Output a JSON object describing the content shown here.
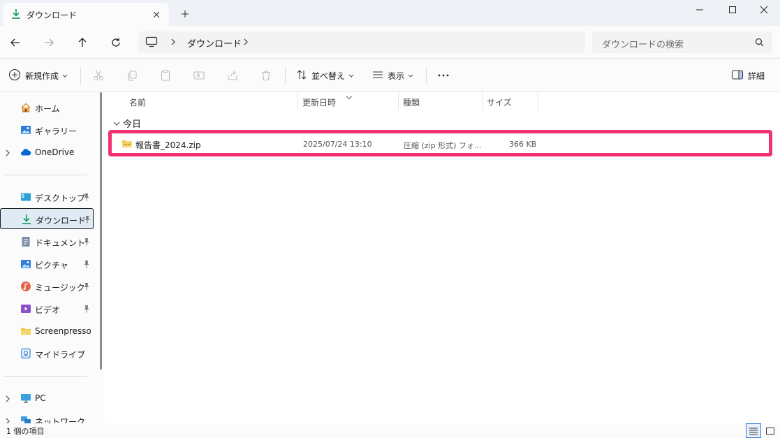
{
  "tab": {
    "title": "ダウンロード"
  },
  "address": {
    "crumb": "ダウンロード"
  },
  "search": {
    "placeholder": "ダウンロードの検索"
  },
  "toolbar": {
    "new_label": "新規作成",
    "sort_label": "並べ替え",
    "view_label": "表示",
    "details_label": "詳細"
  },
  "sidebar": {
    "items": [
      {
        "label": "ホーム"
      },
      {
        "label": "ギャラリー"
      },
      {
        "label": "OneDrive"
      },
      {
        "label": "デスクトップ"
      },
      {
        "label": "ダウンロード"
      },
      {
        "label": "ドキュメント"
      },
      {
        "label": "ピクチャ"
      },
      {
        "label": "ミュージック"
      },
      {
        "label": "ビデオ"
      },
      {
        "label": "Screenpresso"
      },
      {
        "label": "マイドライブ"
      },
      {
        "label": "PC"
      },
      {
        "label": "ネットワーク"
      }
    ]
  },
  "columns": {
    "name": "名前",
    "date": "更新日時",
    "type": "種類",
    "size": "サイズ"
  },
  "group": {
    "label": "今日"
  },
  "file": {
    "name": "報告書_2024.zip",
    "date": "2025/07/24 13:10",
    "type": "圧縮 (zip 形式) フォ...",
    "size": "366 KB"
  },
  "status": {
    "count": "1 個の項目"
  },
  "colors": {
    "accent": "#0f9d58",
    "highlight": "#f0336e",
    "selected_bg": "#dfeaf5"
  }
}
